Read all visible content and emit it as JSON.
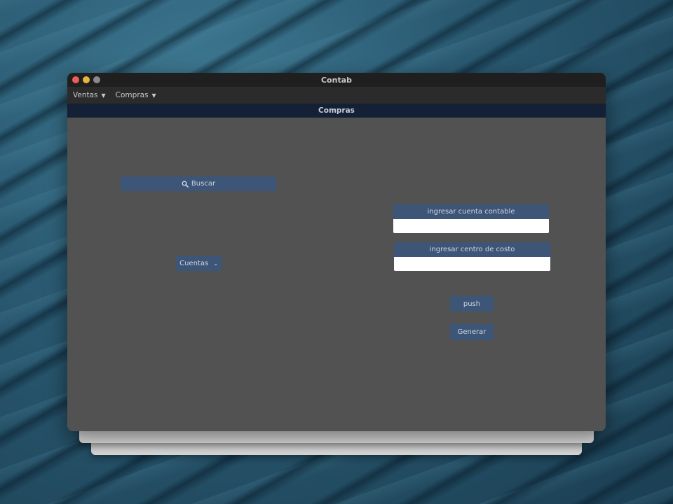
{
  "window": {
    "title": "Contab"
  },
  "menubar": {
    "items": [
      {
        "label": "Ventas",
        "icon": "chevron-down-icon"
      },
      {
        "label": "Compras",
        "icon": "chevron-down-icon"
      }
    ]
  },
  "section": {
    "title": "Compras"
  },
  "buttons": {
    "buscar": {
      "label": "Buscar",
      "icon": "search-icon"
    },
    "cuentas": {
      "label": "Cuentas",
      "icon": "chevron-down-icon"
    },
    "push": {
      "label": "push"
    },
    "generar": {
      "label": "Generar"
    }
  },
  "fields": {
    "cuenta_contable": {
      "label": "ingresar cuenta contable",
      "value": ""
    },
    "centro_costo": {
      "label": "ingresar centro de costo",
      "value": ""
    }
  },
  "colors": {
    "window_bg": "#525252",
    "titlebar": "#1f1f1f",
    "menubar": "#2b2b2b",
    "section_header": "#132036",
    "button": "#3d5577"
  }
}
